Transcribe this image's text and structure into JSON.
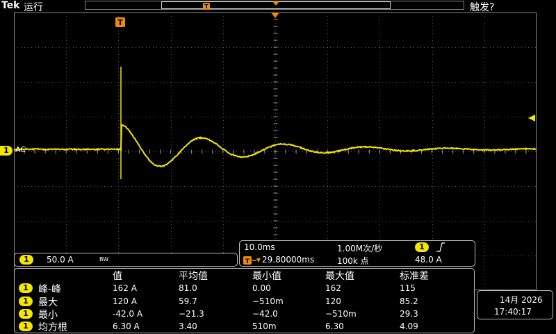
{
  "header": {
    "brand": "Tek",
    "run_state": "运行",
    "trigger_state": "触发?"
  },
  "channel": {
    "number": "1",
    "coupling": "AC",
    "scale": "50.0 A",
    "bandwidth_mark": "BW",
    "color": "#f5e600"
  },
  "trigger": {
    "marker": "T",
    "source": "1",
    "slope_icon": "rising-edge-icon",
    "level": "48.0 A"
  },
  "timebase": {
    "scale": "10.0ms",
    "sample_rate": "1.00M次/秒",
    "position": "29.80000ms",
    "record_length": "100k 点"
  },
  "measurements": {
    "headers": [
      "值",
      "平均值",
      "最小值",
      "最大值",
      "标准差"
    ],
    "rows": [
      {
        "channel": "1",
        "name": "峰-峰",
        "values": [
          "162 A",
          "81.0",
          "0.00",
          "162",
          "115"
        ]
      },
      {
        "channel": "1",
        "name": "最大",
        "values": [
          "120 A",
          "59.7",
          "−510m",
          "120",
          "85.2"
        ]
      },
      {
        "channel": "1",
        "name": "最小",
        "values": [
          "-42.0 A",
          "−21.3",
          "−42.0",
          "−510m",
          "29.3"
        ]
      },
      {
        "channel": "1",
        "name": "均方根",
        "values": [
          "6.30 A",
          "3.40",
          "510m",
          "6.30",
          "4.09"
        ]
      }
    ]
  },
  "clock": {
    "date": "14月 2026",
    "time": "17:40:17"
  }
}
